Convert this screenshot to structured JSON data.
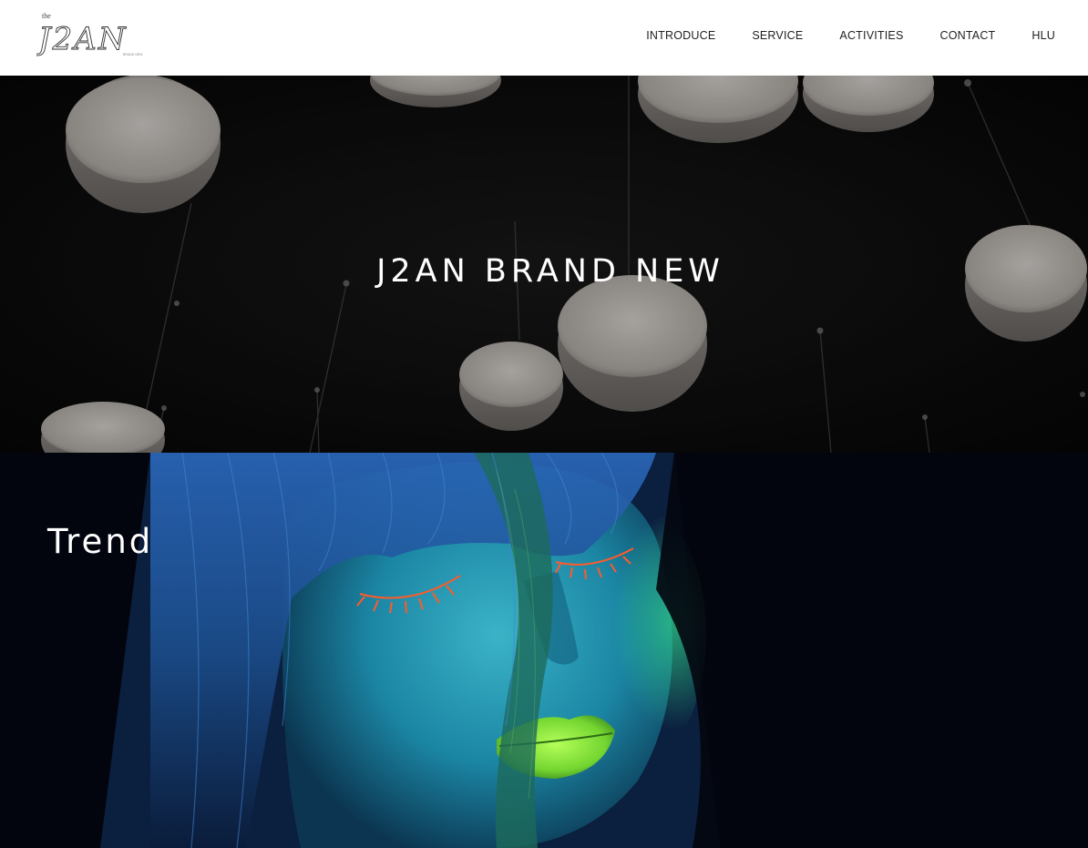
{
  "header": {
    "logo": {
      "small_text": "the",
      "main_text": "J2AN",
      "sub_text": "BRAND NEW"
    },
    "nav": [
      {
        "label": "INTRODUCE"
      },
      {
        "label": "SERVICE"
      },
      {
        "label": "ACTIVITIES"
      },
      {
        "label": "CONTACT"
      },
      {
        "label": "HLU"
      }
    ]
  },
  "hero": {
    "title": "J2AN BRAND NEW",
    "image_icon": "pendant-lamps-image"
  },
  "trend": {
    "title": "Trend",
    "image_icon": "neon-face-portrait-image"
  },
  "colors": {
    "header_bg": "#ffffff",
    "nav_text": "#222222",
    "hero_bg": "#0b0b0b",
    "lamp_fill": "#d6d2cd",
    "trend_bg": "#03050e",
    "face_teal": "#1c8aa6",
    "lips_green": "#7be03a",
    "lash_orange": "#ff5a2a",
    "hair_blue": "#1a4a8c"
  }
}
